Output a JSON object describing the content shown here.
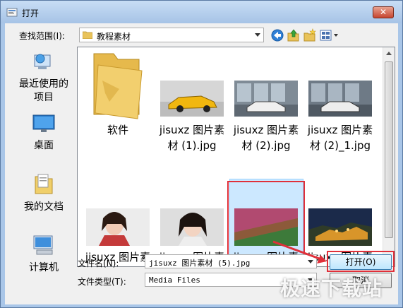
{
  "window": {
    "title": "打开",
    "close_label": "✕"
  },
  "toolbar": {
    "lookin_label": "查找范围(I):",
    "lookin_value": "教程素材"
  },
  "places": [
    {
      "label_line1": "最近使用的",
      "label_line2": "项目",
      "icon": "recent-places-icon"
    },
    {
      "label_line1": "桌面",
      "label_line2": "",
      "icon": "desktop-icon"
    },
    {
      "label_line1": "我的文档",
      "label_line2": "",
      "icon": "documents-icon"
    },
    {
      "label_line1": "计算机",
      "label_line2": "",
      "icon": "computer-icon"
    }
  ],
  "files": [
    {
      "line1": "软件",
      "line2": "",
      "kind": "folder"
    },
    {
      "line1": "jisuxz 图片素",
      "line2": "材 (1).jpg",
      "kind": "image"
    },
    {
      "line1": "jisuxz 图片素",
      "line2": "材 (2).jpg",
      "kind": "image"
    },
    {
      "line1": "jisuxz 图片素",
      "line2": "材 (2)_1.jpg",
      "kind": "image"
    },
    {
      "line1": "jisuxz 图片素",
      "line2": "",
      "kind": "image"
    },
    {
      "line1": "jisuxz 图片素",
      "line2": "",
      "kind": "image"
    },
    {
      "line1": "jisuxz 图片素",
      "line2": "",
      "kind": "image"
    },
    {
      "line1": "jisuxz 图片素",
      "line2": "",
      "kind": "image"
    }
  ],
  "form": {
    "filename_label": "文件名(N):",
    "filename_value": "jisuxz 图片素材 (5).jpg",
    "filetype_label": "文件类型(T):",
    "filetype_value": "Media Files",
    "open_label": "打开(O)",
    "cancel_label": "取消"
  },
  "watermark": "极速下载站",
  "colors": {
    "highlight": "#e0303a",
    "selection": "#cce8ff",
    "title_bar": "#a9c6e8"
  }
}
